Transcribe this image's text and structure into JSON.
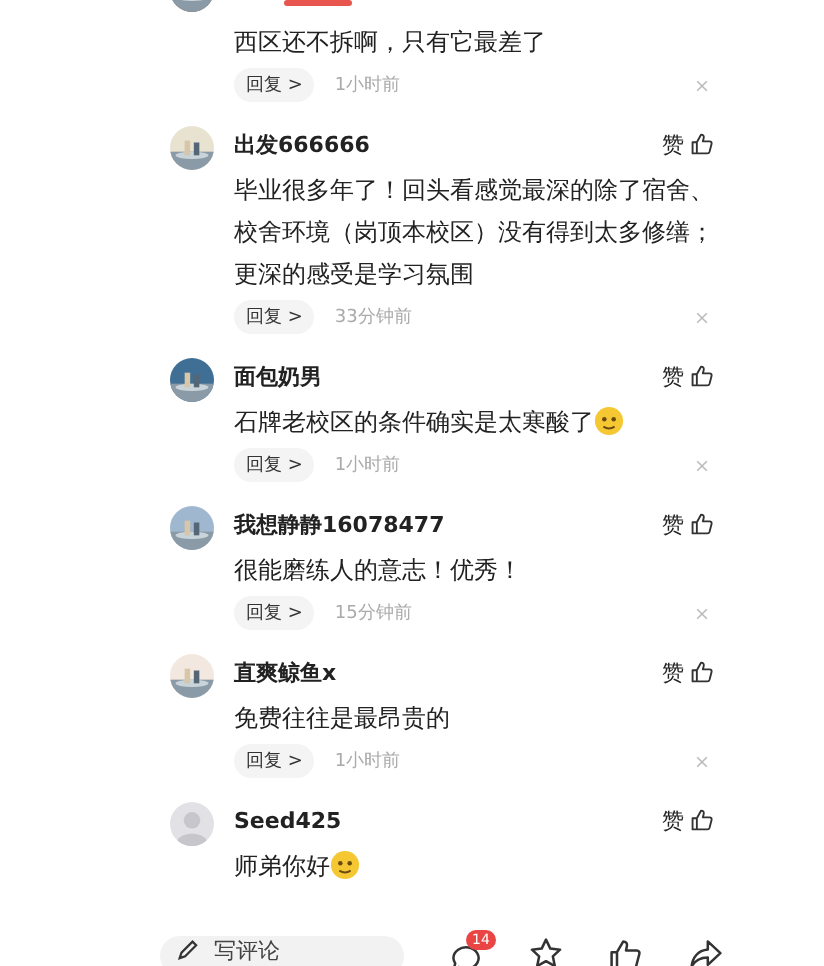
{
  "comments": [
    {
      "default_avatar": false,
      "text": "西区还不拆啊，只有它最差了",
      "emoji": false,
      "reply": "回复 >",
      "time": "1小时前"
    },
    {
      "default_avatar": false,
      "name": "出发666666",
      "text": "毕业很多年了！回头看感觉最深的除了宿舍、校舍环境（岗顶本校区）没有得到太多修缮；更深的感受是学习氛围",
      "emoji": false,
      "reply": "回复 >",
      "time": "33分钟前",
      "like": "赞"
    },
    {
      "default_avatar": false,
      "name": "面包奶男",
      "text": "石牌老校区的条件确实是太寒酸了",
      "emoji": true,
      "reply": "回复 >",
      "time": "1小时前",
      "like": "赞"
    },
    {
      "default_avatar": false,
      "name": "我想静静16078477",
      "text": "很能磨练人的意志！优秀！",
      "emoji": false,
      "reply": "回复 >",
      "time": "15分钟前",
      "like": "赞"
    },
    {
      "default_avatar": false,
      "name": "直爽鲸鱼x",
      "text": "免费往往是最昂贵的",
      "emoji": false,
      "reply": "回复 >",
      "time": "1小时前",
      "like": "赞"
    },
    {
      "default_avatar": true,
      "name": "Seed425",
      "text": "师弟你好",
      "emoji": true,
      "like": "赞"
    }
  ],
  "bottom_bar": {
    "placeholder": "写评论",
    "comment_count": "14"
  }
}
